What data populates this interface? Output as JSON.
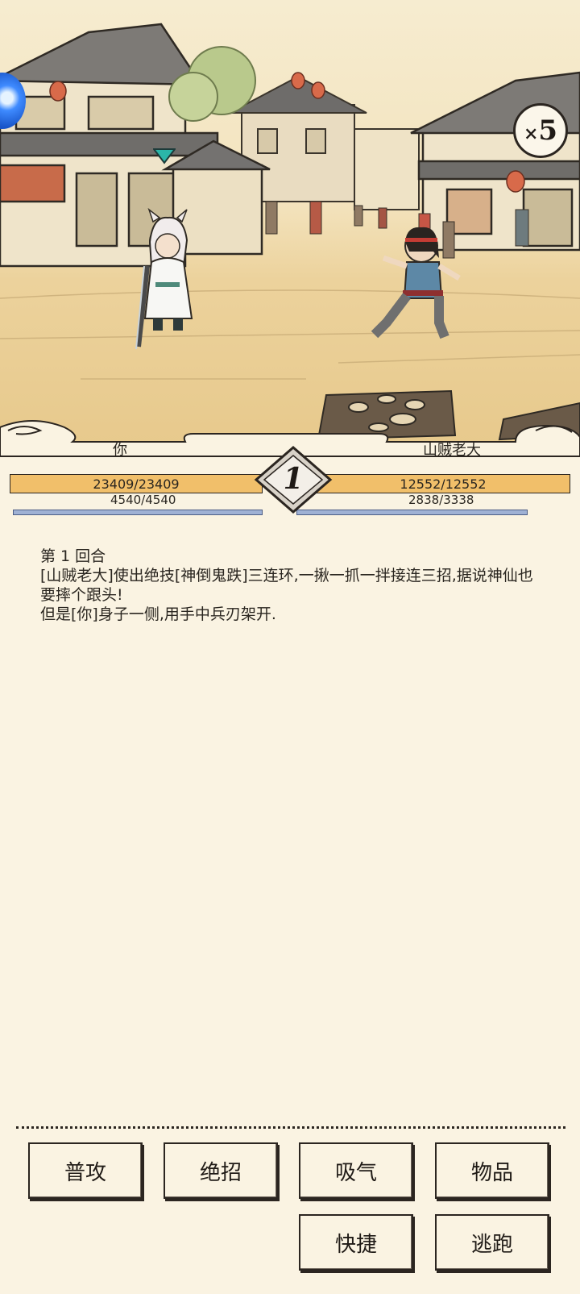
{
  "scene": {
    "speed_multiplier": "5",
    "speed_prefix": "×"
  },
  "combat": {
    "round": "1",
    "player": {
      "name": "你",
      "hp": "23409/23409",
      "mp": "4540/4540",
      "hp_fill": 1.0,
      "mp_fill": 1.0
    },
    "enemy": {
      "name": "山贼老大",
      "hp": "12552/12552",
      "mp": "2838/3338",
      "hp_fill": 1.0,
      "mp_fill": 0.85
    }
  },
  "log": [
    "第 1 回合",
    "[山贼老大]使出绝技[神倒鬼跌]三连环,一揪一抓一拌接连三招,据说神仙也要摔个跟头!",
    "但是[你]身子一侧,用手中兵刃架开."
  ],
  "actions": {
    "attack": "普攻",
    "ultimate": "绝招",
    "breathe": "吸气",
    "items": "物品",
    "quick": "快捷",
    "flee": "逃跑"
  },
  "colors": {
    "hp_bar": "#f1bf6a",
    "mp_bar": "#9fb1d4",
    "parchment": "#faf3e2",
    "ink": "#2b2520"
  }
}
